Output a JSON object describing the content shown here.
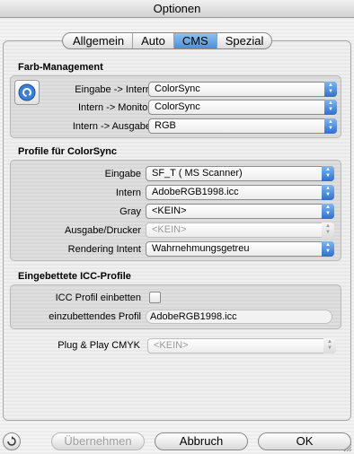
{
  "window": {
    "title": "Optionen"
  },
  "tabs": [
    {
      "label": "Allgemein"
    },
    {
      "label": "Auto"
    },
    {
      "label": "CMS"
    },
    {
      "label": "Spezial"
    }
  ],
  "farb_management": {
    "title": "Farb-Management",
    "rows": [
      {
        "label": "Eingabe -> Intern",
        "value": "ColorSync"
      },
      {
        "label": "Intern -> Monitor",
        "value": "ColorSync"
      },
      {
        "label": "Intern -> Ausgabe",
        "value": "RGB"
      }
    ]
  },
  "profile": {
    "title": "Profile für ColorSync",
    "rows": [
      {
        "label": "Eingabe",
        "value": "SF_T ( MS Scanner)"
      },
      {
        "label": "Intern",
        "value": "AdobeRGB1998.icc"
      },
      {
        "label": "Gray",
        "value": "<KEIN>"
      },
      {
        "label": "Ausgabe/Drucker",
        "value": "<KEIN>"
      },
      {
        "label": "Rendering Intent",
        "value": "Wahrnehmungsgetreu"
      }
    ]
  },
  "icc": {
    "title": "Eingebettete ICC-Profile",
    "embed_label": "ICC Profil einbetten",
    "profile_label": "einzubettendes Profil",
    "profile_value": "AdobeRGB1998.icc"
  },
  "plug_play": {
    "label": "Plug & Play CMYK",
    "value": "<KEIN>"
  },
  "buttons": {
    "apply": "Übernehmen",
    "cancel": "Abbruch",
    "ok": "OK"
  },
  "colors": {
    "accent": "#3a7fd8",
    "disabled_text": "#9a9a9a"
  }
}
